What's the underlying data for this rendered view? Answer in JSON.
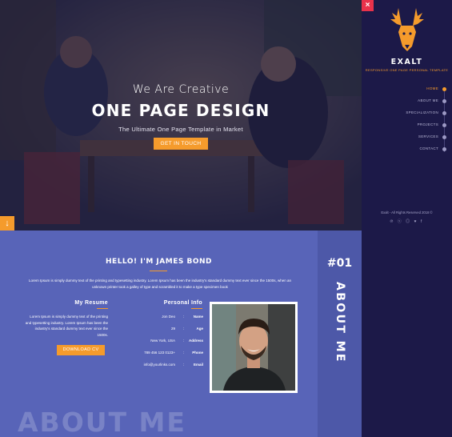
{
  "hero": {
    "subtitle": "We Are Creative",
    "title": "ONE PAGE DESIGN",
    "tagline": "The Ultimate One Page Template in Market",
    "cta_label": "GET IN TOUCH",
    "scroll_down_icon": "arrow-down-icon"
  },
  "sidebar": {
    "close_label": "×",
    "logo_name": "EXALT",
    "logo_tagline": "RESPONSIVE ONE PAGE PERSONAL TEMPLATE",
    "nav": [
      {
        "label": "HOME",
        "active": true
      },
      {
        "label": "ABOUT ME",
        "active": false
      },
      {
        "label": "SPECIALIZATION",
        "active": false
      },
      {
        "label": "PROJECTS",
        "active": false
      },
      {
        "label": "SERVICES",
        "active": false
      },
      {
        "label": "CONTACT",
        "active": false
      }
    ],
    "copyright": "Exalt - All Rights Reserved 2018 ©",
    "socials": [
      "pinterest-icon",
      "skype-icon",
      "instagram-icon",
      "twitter-icon",
      "facebook-icon"
    ]
  },
  "about": {
    "number": "#01",
    "vertical_title": "ABOUT ME",
    "heading": "HELLO! I'M JAMES BOND",
    "intro": "Lorem Ipsum is simply dummy text of the printing and typesetting industry. Lorem Ipsum has been the industry's standard dummy text ever since the 1500s, when an unknown printer took a galley of type and scrambled it to make a type specimen book",
    "resume_title": "My Resume",
    "resume_text": "Lorem Ipsum is simply dummy text of the printing and typesetting industry. Lorem Ipsum has been the industry's standard dummy text ever since the 1500s.",
    "download_label": "DOWNLOAD CV",
    "personal_title": "Personal Info",
    "personal": [
      {
        "value": "Jon Deo",
        "key": "Name"
      },
      {
        "value": "29",
        "key": "Age"
      },
      {
        "value": "New York, USA",
        "key": "Address"
      },
      {
        "value": "789 456 123 0123+",
        "key": "Phone"
      },
      {
        "value": "info@yourlinks.com",
        "key": "Email"
      }
    ],
    "watermark": "ABOUT ME"
  },
  "colors": {
    "accent": "#f59b2c",
    "sidebar_bg": "#1c1948",
    "about_bg": "#5864b8",
    "close_bg": "#e8324b"
  }
}
